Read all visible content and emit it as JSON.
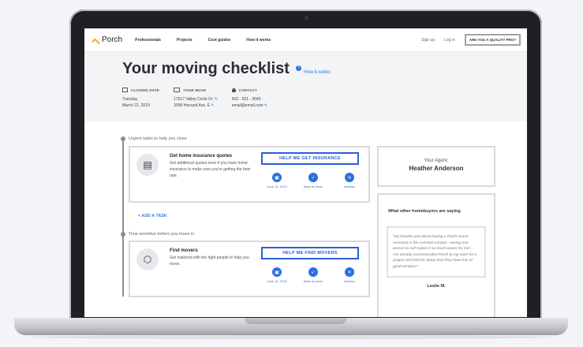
{
  "nav": {
    "logo": "Porch",
    "links": [
      "Professionals",
      "Projects",
      "Cost guides",
      "How it works"
    ],
    "sign_up": "Sign up",
    "log_in": "Log in",
    "pro_button": "ARE YOU A QUALITY PRO?"
  },
  "header": {
    "title": "Your moving checklist",
    "how_it_works": "How it works",
    "closing": {
      "label": "CLOSING DATE",
      "line1": "Tuesday,",
      "line2": "March 22, 2019"
    },
    "move": {
      "label": "YOUR MOVE",
      "line1": "17617 Valley Circle Dr.",
      "line2": "3008 Harvard Ave. E"
    },
    "contact": {
      "label": "CONTACT",
      "line1": "503 - 551 - 2649",
      "line2": "email@email.com"
    }
  },
  "sections": {
    "urgent": "Urgent tasks to help you close",
    "time_sensitive": "Time sensitive before you move in"
  },
  "tasks": [
    {
      "title": "Get home insurance quotes",
      "desc": "Get additional quotes even if you have home insurance to make sure you're getting the best rate.",
      "cta": "HELP ME GET INSURANCE",
      "date": "June 12, 2019",
      "done": "Mark as done",
      "dismiss": "Dismiss"
    },
    {
      "title": "Find movers",
      "desc": "Get matched with the right people to help you move.",
      "cta": "HELP ME FIND MOVERS",
      "date": "June 12, 2019",
      "done": "Mark as done",
      "dismiss": "Dismiss"
    }
  ],
  "add_task": "+ ADD A TASK",
  "agent": {
    "label": "Your Agent:",
    "name": "Heather Anderson"
  },
  "testimonials": {
    "title": "What other homebuyers are saying",
    "quote": "\"My favorite part about having a Porch Home Assistant is the constant contact. Having one person to call makes it so much easier for me! .. I've already recommended Porch to my mom for a project and told her about how they have lots of good vendors!\"",
    "author": "Leslie M."
  },
  "colors": {
    "accent": "#2b5fd9",
    "logo": "#f7a823",
    "border": "#d9dadf"
  }
}
